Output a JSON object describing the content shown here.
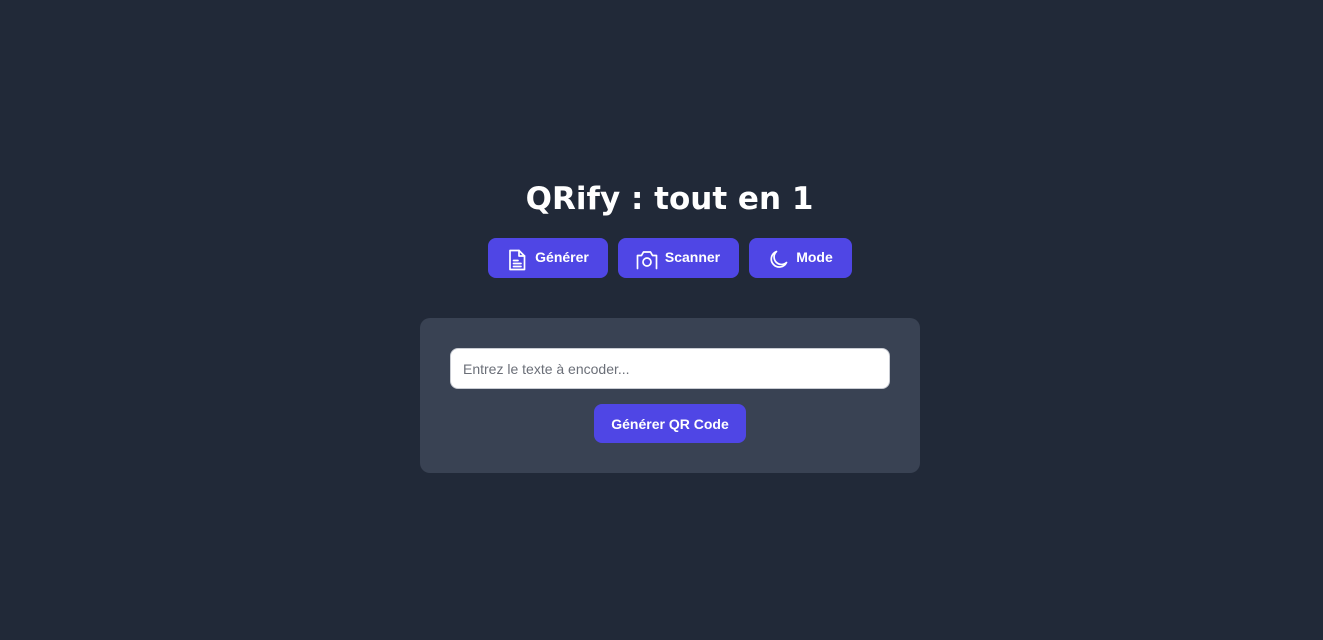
{
  "app": {
    "title": "QRify : tout en 1"
  },
  "nav": {
    "items": [
      {
        "label": "Générer",
        "icon": "file-text-icon"
      },
      {
        "label": "Scanner",
        "icon": "camera-icon"
      },
      {
        "label": "Mode",
        "icon": "moon-icon"
      }
    ]
  },
  "generator": {
    "input": {
      "value": "",
      "placeholder": "Entrez le texte à encoder..."
    },
    "button_label": "Générer QR Code"
  },
  "colors": {
    "background": "#212938",
    "card": "#394253",
    "accent": "#4f46e5",
    "text": "#ffffff"
  }
}
